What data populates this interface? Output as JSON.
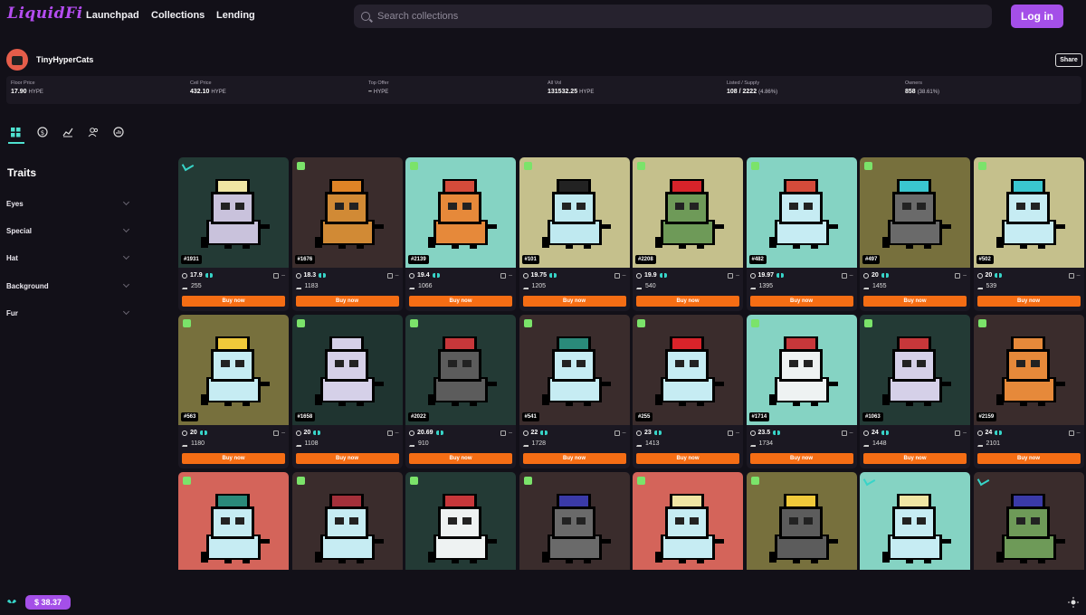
{
  "app": {
    "logo_text": "LiquidFi",
    "accent": "#a44fe8",
    "cta_color": "#f56d14"
  },
  "nav": {
    "links": [
      "Launchpad",
      "Collections",
      "Lending"
    ],
    "search_placeholder": "Search collections",
    "login_label": "Log in"
  },
  "collection": {
    "name": "TinyHyperCats",
    "share_label": "Share",
    "stats": [
      {
        "label": "Floor Price",
        "value": "17.90",
        "unit": "HYPE"
      },
      {
        "label": "Ceil Price",
        "value": "432.10",
        "unit": "HYPE"
      },
      {
        "label": "Top Offer",
        "value": "–",
        "unit": "HYPE"
      },
      {
        "label": "All Vol",
        "value": "131532.25",
        "unit": "HYPE"
      },
      {
        "label": "Listed / Supply",
        "value": "108 / 2222",
        "unit": "(4.86%)"
      },
      {
        "label": "Owners",
        "value": "858",
        "unit": "(38.61%)"
      }
    ]
  },
  "tabs": [
    "grid-icon",
    "dollar-icon",
    "chart-line-icon",
    "users-icon",
    "gauge-icon"
  ],
  "traits": {
    "title": "Traits",
    "items": [
      "Eyes",
      "Special",
      "Hat",
      "Background",
      "Fur"
    ]
  },
  "buy_label": "Buy now",
  "items": [
    {
      "id": "#1931",
      "price": "17.9",
      "count": "255",
      "bg": "#233a35",
      "fur": "#c9c2dc",
      "hat": "#f0e6a4",
      "badge": "blue"
    },
    {
      "id": "#1676",
      "price": "18.3",
      "count": "1183",
      "bg": "#3a2c2c",
      "fur": "#d18a35",
      "hat": "#e08426",
      "badge": "green"
    },
    {
      "id": "#2139",
      "price": "19.4",
      "count": "1066",
      "bg": "#85d3c3",
      "fur": "#e6893a",
      "hat": "#d44b3a",
      "badge": "green"
    },
    {
      "id": "#101",
      "price": "19.75",
      "count": "1205",
      "bg": "#c5c08c",
      "fur": "#bfe9f0",
      "hat": "#222222",
      "badge": "green"
    },
    {
      "id": "#2208",
      "price": "19.9",
      "count": "540",
      "bg": "#c5c08c",
      "fur": "#6e9a58",
      "hat": "#d8232a",
      "badge": "green"
    },
    {
      "id": "#482",
      "price": "19.97",
      "count": "1395",
      "bg": "#85d3c3",
      "fur": "#c6ecf3",
      "hat": "#d44b3a",
      "badge": "green"
    },
    {
      "id": "#497",
      "price": "20",
      "count": "1455",
      "bg": "#77703d",
      "fur": "#6a6a6a",
      "hat": "#3ac6cf",
      "badge": "green"
    },
    {
      "id": "#502",
      "price": "20",
      "count": "539",
      "bg": "#c5c08c",
      "fur": "#c6ecf3",
      "hat": "#3ac6cf",
      "badge": "green"
    },
    {
      "id": "#563",
      "price": "20",
      "count": "1180",
      "bg": "#77703d",
      "fur": "#c6ecf3",
      "hat": "#f0c93a",
      "badge": "green"
    },
    {
      "id": "#1658",
      "price": "20",
      "count": "1108",
      "bg": "#1f3430",
      "fur": "#d5d0e8",
      "hat": "#d5d0e8",
      "badge": "green"
    },
    {
      "id": "#2022",
      "price": "20.69",
      "count": "910",
      "bg": "#233a35",
      "fur": "#5c5c5c",
      "hat": "#c7373a",
      "badge": "green"
    },
    {
      "id": "#541",
      "price": "22",
      "count": "1728",
      "bg": "#3a2c2c",
      "fur": "#c6ecf3",
      "hat": "#2a8a7a",
      "badge": "green"
    },
    {
      "id": "#255",
      "price": "23",
      "count": "1413",
      "bg": "#3a2c2c",
      "fur": "#c6ecf3",
      "hat": "#d8232a",
      "badge": "green"
    },
    {
      "id": "#1714",
      "price": "23.5",
      "count": "1734",
      "bg": "#85d3c3",
      "fur": "#eef2f2",
      "hat": "#c7373a",
      "badge": "green"
    },
    {
      "id": "#1063",
      "price": "24",
      "count": "1448",
      "bg": "#233a35",
      "fur": "#d5d0e8",
      "hat": "#c7373a",
      "badge": "green"
    },
    {
      "id": "#2159",
      "price": "24",
      "count": "2101",
      "bg": "#3a2c2c",
      "fur": "#e6893a",
      "hat": "#e6893a",
      "badge": "green"
    },
    {
      "id": "",
      "price": "",
      "count": "",
      "bg": "#d4645a",
      "fur": "#c6ecf3",
      "hat": "#2a8a7a",
      "badge": "green"
    },
    {
      "id": "",
      "price": "",
      "count": "",
      "bg": "#3a2c2c",
      "fur": "#c6ecf3",
      "hat": "#a3303a",
      "badge": "green"
    },
    {
      "id": "",
      "price": "",
      "count": "",
      "bg": "#233a35",
      "fur": "#eef2f2",
      "hat": "#c7373a",
      "badge": "green"
    },
    {
      "id": "",
      "price": "",
      "count": "",
      "bg": "#3a2c2c",
      "fur": "#6a6a6a",
      "hat": "#3a3aa8",
      "badge": "green"
    },
    {
      "id": "",
      "price": "",
      "count": "",
      "bg": "#d4645a",
      "fur": "#c6ecf3",
      "hat": "#f0e6a4",
      "badge": "green"
    },
    {
      "id": "",
      "price": "",
      "count": "",
      "bg": "#77703d",
      "fur": "#5c5c5c",
      "hat": "#f0c93a",
      "badge": "green"
    },
    {
      "id": "",
      "price": "",
      "count": "",
      "bg": "#85d3c3",
      "fur": "#c6ecf3",
      "hat": "#f0e6a4",
      "badge": "blue"
    },
    {
      "id": "",
      "price": "",
      "count": "",
      "bg": "#3a2c2c",
      "fur": "#6e9a58",
      "hat": "#3a3aa8",
      "badge": "blue"
    }
  ],
  "footer": {
    "wallet_balance": "$ 38.37"
  }
}
